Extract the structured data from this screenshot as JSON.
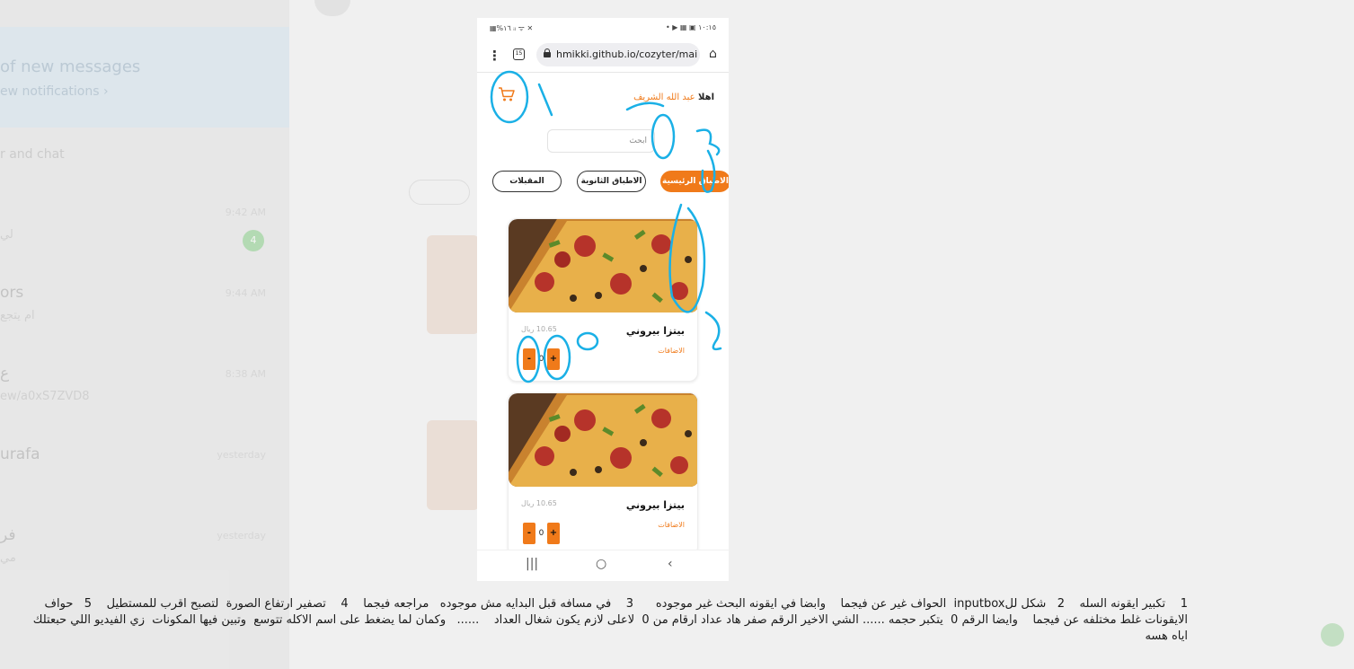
{
  "background": {
    "banner_title": "of new messages",
    "banner_link": "ew notifications ›",
    "search_hint": "r and chat",
    "rows": [
      {
        "name": "",
        "preview": "لي",
        "time": "9:42 AM",
        "badge": "4"
      },
      {
        "name": "ors",
        "preview": "ام يتجع",
        "time": "9:44 AM",
        "badge": ""
      },
      {
        "name": "ع",
        "preview": "ew/a0xS7ZVD8",
        "time": "8:38 AM",
        "badge": ""
      },
      {
        "name": "urafa",
        "preview": "",
        "time": "yesterday",
        "badge": ""
      },
      {
        "name": "فر",
        "preview": "مي",
        "time": "yesterday",
        "badge": ""
      }
    ]
  },
  "phone": {
    "status_left": "▦%١٦ ᵢₗ ᯤ ✕",
    "status_right": "• ▶ ▦ ▣ ١٠:١٥",
    "url": "hmikki.github.io/cozyter/mai",
    "kebab": "⋮",
    "home": "⌂",
    "tabs_count": "15",
    "greeting_prefix": "اهلا ",
    "greeting_name": "عبد الله الشريف",
    "search_placeholder": "ابحث",
    "categories": [
      "المقبلات",
      "الاطباق الثانوية",
      "الاطباق الرئيسية"
    ],
    "products": [
      {
        "name": "بيتزا بيروني",
        "price": "10.65 ريال",
        "addons": "الاضافات",
        "qty": "0",
        "minus": "-",
        "plus": "+"
      },
      {
        "name": "بيتزا بيروني",
        "price": "10.65 ريال",
        "addons": "الاضافات",
        "qty": "0",
        "minus": "-",
        "plus": "+"
      }
    ],
    "nav": [
      "|||",
      "○",
      "‹"
    ]
  },
  "caption": "1    تكبير ايقونه السله    2   شكل للinputbox  الحواف غير عن فيجما    وابضا في ايقونه البحث غير موجوده      3    في مسافه قبل البدايه مش موجوده   مراجعه فيجما    4    تصفير ارتفاع الصورة  لتصبح اقرب للمستطيل    5   حواف الايقونات غلط مختلفه عن فيجما    وايضا الرقم 0  يتكبر حجمه ...... الشي الاخير الرقم صفر هاد عداد ارقام من 0  لاعلى لازم يكون شغال العداد    ......   وكمان لما يضغط على اسم الاكله تتوسع  وتبين فيها المكونات  زي الفيديو اللي حبعتلك اياه هسه",
  "colors": {
    "accent": "#f07a1a",
    "annotation": "#1ab0e6"
  }
}
